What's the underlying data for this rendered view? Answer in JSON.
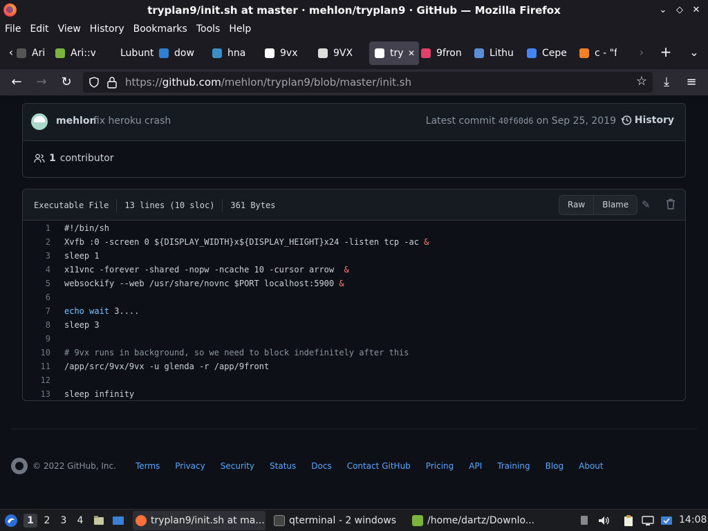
{
  "window": {
    "title": "tryplan9/init.sh at master · mehlon/tryplan9 · GitHub — Mozilla Firefox",
    "minimize": "⌄",
    "restore": "◇",
    "close": "✕"
  },
  "menu": [
    "File",
    "Edit",
    "View",
    "History",
    "Bookmarks",
    "Tools",
    "Help"
  ],
  "tabs": [
    {
      "label": "Ari::v",
      "color": "#555555"
    },
    {
      "label": "Ari::v",
      "color": "#7ab33e"
    },
    {
      "label": "Lubuntu",
      "color": "#1c1b22"
    },
    {
      "label": "dow",
      "color": "#2f7fd3"
    },
    {
      "label": "hna",
      "color": "#3a8fc8"
    },
    {
      "label": "9vx",
      "color": "#ffffff"
    },
    {
      "label": "9VX",
      "color": "#dddddd"
    },
    {
      "label": "try",
      "color": "#ffffff",
      "active": true,
      "close": "✕"
    },
    {
      "label": "9fron",
      "color": "#e0406a"
    },
    {
      "label": "Lithu",
      "color": "#5a8fd6"
    },
    {
      "label": "Cepe",
      "color": "#4285f4"
    },
    {
      "label": "c - \"f",
      "color": "#f48024"
    }
  ],
  "tabstrip": {
    "scroll_left": "‹",
    "scroll_right": "›",
    "new_tab": "+",
    "list_all": "⌄"
  },
  "nav": {
    "back": "←",
    "forward": "→",
    "reload": "↻",
    "url_prefix": "https://",
    "url_host": "github.com",
    "url_path": "/mehlon/tryplan9/blob/master/init.sh",
    "bookmark": "☆",
    "downloads": "⤓",
    "menu": "≡"
  },
  "commit": {
    "author": "mehlon",
    "message": "fix heroku crash",
    "latest_label": "Latest commit",
    "sha": "40f60d6",
    "date": "on Sep 25, 2019",
    "history_label": "History",
    "contributor_count": "1",
    "contributor_label": "contributor"
  },
  "file": {
    "mode": "Executable File",
    "lines": "13 lines (10 sloc)",
    "size": "361 Bytes",
    "raw_label": "Raw",
    "blame_label": "Blame",
    "edit_icon": "✎",
    "delete_icon": "🗑"
  },
  "code": [
    {
      "n": "1",
      "parts": [
        [
          "",
          "#!/bin/sh"
        ]
      ]
    },
    {
      "n": "2",
      "parts": [
        [
          "",
          "Xvfb :0 -screen 0 ${DISPLAY_WIDTH}x${DISPLAY_HEIGHT}x24 -listen tcp -ac "
        ],
        [
          "amp",
          "&"
        ]
      ]
    },
    {
      "n": "3",
      "parts": [
        [
          "",
          "sleep 1"
        ]
      ]
    },
    {
      "n": "4",
      "parts": [
        [
          "",
          "x11vnc -forever -shared -nopw -ncache 10 -cursor arrow  "
        ],
        [
          "amp",
          "&"
        ]
      ]
    },
    {
      "n": "5",
      "parts": [
        [
          "",
          "websockify --web /usr/share/novnc $PORT localhost:5900 "
        ],
        [
          "amp",
          "&"
        ]
      ]
    },
    {
      "n": "6",
      "parts": [
        [
          "",
          ""
        ]
      ]
    },
    {
      "n": "7",
      "parts": [
        [
          "kw",
          "echo wait"
        ],
        [
          "",
          " 3...."
        ]
      ]
    },
    {
      "n": "8",
      "parts": [
        [
          "",
          "sleep 3"
        ]
      ]
    },
    {
      "n": "9",
      "parts": [
        [
          "",
          ""
        ]
      ]
    },
    {
      "n": "10",
      "parts": [
        [
          "cmt",
          "# 9vx runs in background, so we need to block indefinitely after this"
        ]
      ]
    },
    {
      "n": "11",
      "parts": [
        [
          "",
          "/app/src/9vx/9vx -u glenda -r /app/9front"
        ]
      ]
    },
    {
      "n": "12",
      "parts": [
        [
          "",
          ""
        ]
      ]
    },
    {
      "n": "13",
      "parts": [
        [
          "",
          "sleep infinity"
        ]
      ]
    }
  ],
  "footer": {
    "copyright": "© 2022 GitHub, Inc.",
    "links": [
      "Terms",
      "Privacy",
      "Security",
      "Status",
      "Docs",
      "Contact GitHub",
      "Pricing",
      "API",
      "Training",
      "Blog",
      "About"
    ]
  },
  "taskbar": {
    "workspaces": [
      "1",
      "2",
      "3",
      "4"
    ],
    "tasks": [
      {
        "label": "tryplan9/init.sh at ma...",
        "color": "#ff7139",
        "active": true
      },
      {
        "label": "qterminal - 2 windows",
        "color": "#555555"
      },
      {
        "label": "/home/dartz/Downlo...",
        "color": "#7ab33e"
      }
    ],
    "clock": "14:08"
  }
}
